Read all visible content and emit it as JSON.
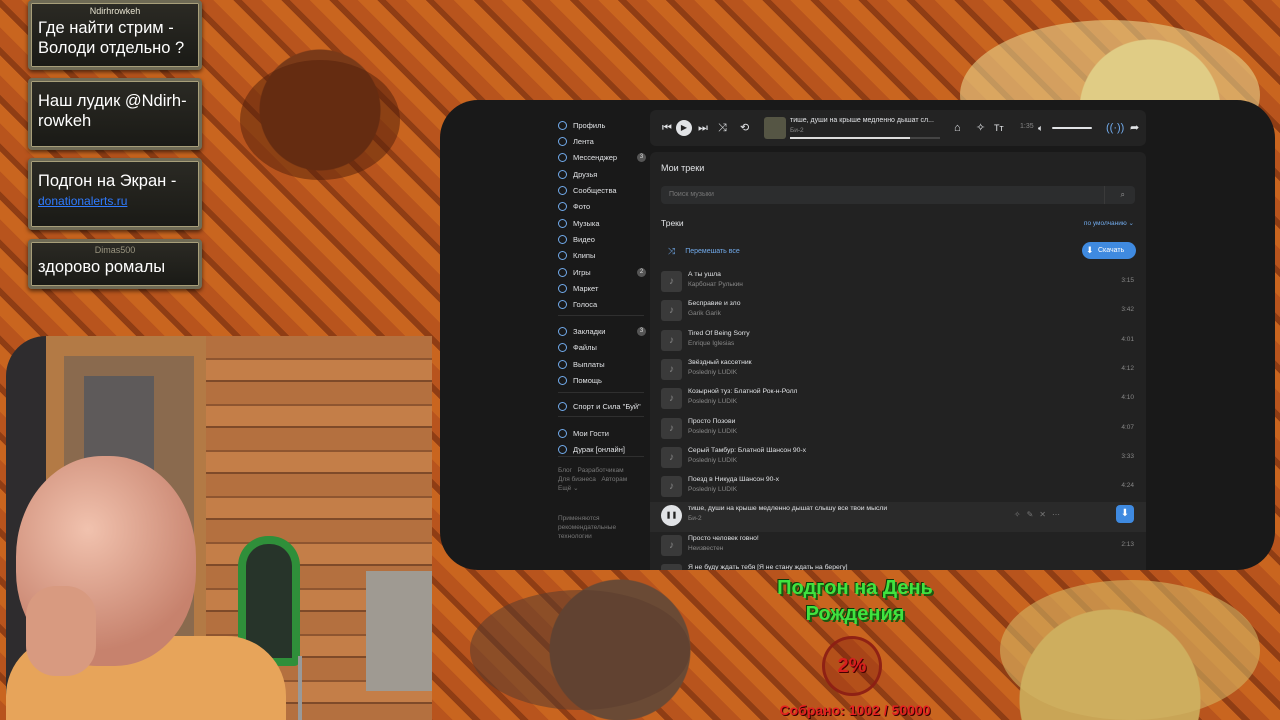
{
  "chat": {
    "messages": [
      {
        "author": "Ndirhrowkeh",
        "text": "Где найти стрим - Володи отдельно ?"
      },
      {
        "author": "",
        "text": "Наш лудик @Ndirh-rowkeh"
      },
      {
        "author": "",
        "text": "Подгон на Экран -",
        "link": "donationalerts.ru"
      },
      {
        "author": "Dimas500",
        "text": "здорово ромалы"
      }
    ]
  },
  "vk": {
    "sidebar": {
      "items": [
        {
          "label": "Профиль",
          "badge": ""
        },
        {
          "label": "Лента",
          "badge": ""
        },
        {
          "label": "Мессенджер",
          "badge": "3"
        },
        {
          "label": "Друзья",
          "badge": ""
        },
        {
          "label": "Сообщества",
          "badge": ""
        },
        {
          "label": "Фото",
          "badge": ""
        },
        {
          "label": "Музыка",
          "badge": ""
        },
        {
          "label": "Видео",
          "badge": ""
        },
        {
          "label": "Клипы",
          "badge": ""
        },
        {
          "label": "Игры",
          "badge": "2"
        },
        {
          "label": "Маркет",
          "badge": ""
        },
        {
          "label": "Голоса",
          "badge": ""
        },
        {
          "label": "Закладки",
          "badge": "3"
        },
        {
          "label": "Файлы",
          "badge": ""
        },
        {
          "label": "Выплаты",
          "badge": ""
        },
        {
          "label": "Помощь",
          "badge": ""
        },
        {
          "label": "Спорт и Сила \"Буй\"",
          "badge": ""
        },
        {
          "label": "Мои Гости",
          "badge": ""
        },
        {
          "label": "Дурак [онлайн]",
          "badge": ""
        }
      ],
      "footer_links": [
        "Блог",
        "Разработчикам",
        "Для бизнеса",
        "Авторам",
        "Ещё"
      ],
      "footer_note": "Применяются рекомендательные технологии"
    },
    "player": {
      "title": "тише, души на крыше медленно дышат сл...",
      "artist": "Би-2",
      "time": "1:35",
      "progress": 0.8
    },
    "main": {
      "title": "Мои треки",
      "search_placeholder": "Поиск музыки",
      "tracks_heading": "Треки",
      "sort_label": "по умолчанию",
      "shuffle_label": "Перемешать все",
      "download_label": "Скачать"
    },
    "tracks": [
      {
        "title": "А ты ушла",
        "artist": "Карбонат Рулькин",
        "duration": "3:15"
      },
      {
        "title": "Бесправие и зло",
        "artist": "Garik Garik",
        "duration": "3:42"
      },
      {
        "title": "Tired Of Being Sorry",
        "artist": "Enrique Iglesias",
        "duration": "4:01"
      },
      {
        "title": "Звёздный кассетник",
        "artist": "Posledniy LUDIK",
        "duration": "4:12"
      },
      {
        "title": "Козырной туз: Блатной Рок-н-Ролл",
        "artist": "Posledniy LUDIK",
        "duration": "4:10"
      },
      {
        "title": "Просто Позови",
        "artist": "Posledniy LUDIK",
        "duration": "4:07"
      },
      {
        "title": "Серый Тамбур: Блатной Шансон 90-х",
        "artist": "Posledniy LUDIK",
        "duration": "3:33"
      },
      {
        "title": "Поезд в Никуда Шансон 90-х",
        "artist": "Posledniy LUDIK",
        "duration": "4:24"
      },
      {
        "title": "тише, души на крыше медленно дышат слышу все твои мысли",
        "artist": "Би-2",
        "duration": ""
      },
      {
        "title": "Просто человек говно!",
        "artist": "Неизвестен",
        "duration": "2:13"
      },
      {
        "title": "Я не буду ждать тебя [Я не стану ждать на берегу]",
        "artist": "",
        "duration": ""
      }
    ]
  },
  "donation": {
    "title": "Подгон на День Рождения",
    "percent": "2%",
    "collected": "Собрано: 1002 / 50000"
  }
}
